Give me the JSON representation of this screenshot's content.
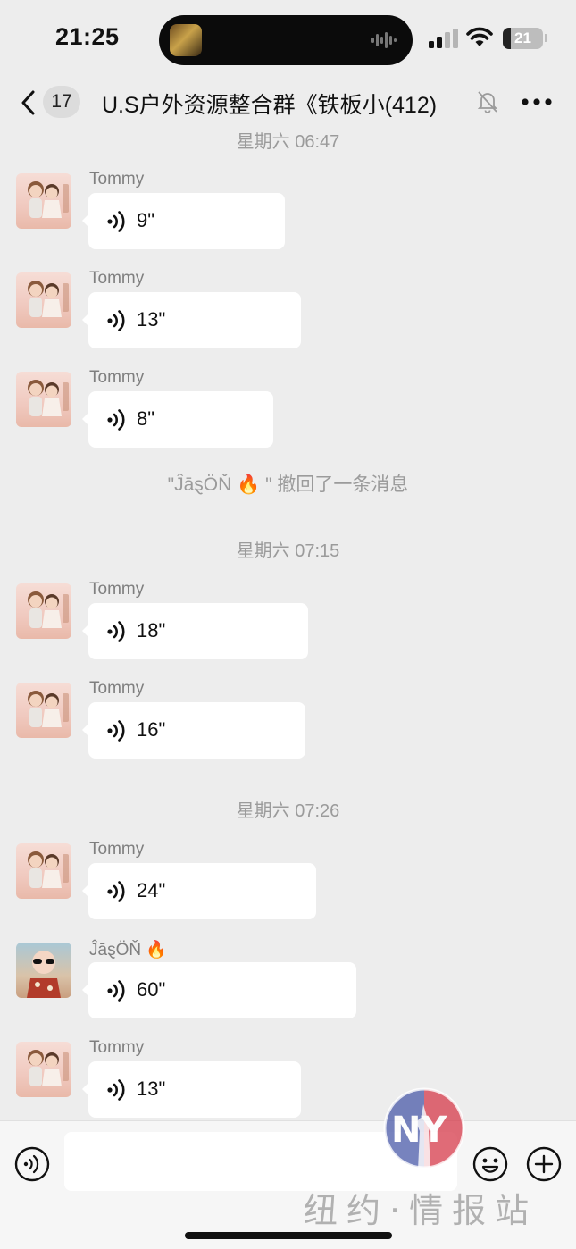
{
  "status_bar": {
    "time": "21:25",
    "battery_level": "21",
    "battery_percent": 21
  },
  "nav": {
    "back_icon": "chevron-left-icon",
    "unread_count": "17",
    "title": "U.S户外资源整合群《铁板小",
    "member_count": "(412)",
    "mute_icon": "bell-slash-icon",
    "more_icon": "ellipsis-icon"
  },
  "timeline": {
    "divider_1": "星期六 06:47",
    "divider_2": "星期六 07:15",
    "divider_3": "星期六 07:26",
    "recall_notice": "\"ĴāȿÖŇ 🔥 \" 撤回了一条消息"
  },
  "messages": [
    {
      "sender": "Tommy",
      "duration": "9\""
    },
    {
      "sender": "Tommy",
      "duration": "13\""
    },
    {
      "sender": "Tommy",
      "duration": "8\""
    },
    {
      "sender": "Tommy",
      "duration": "18\""
    },
    {
      "sender": "Tommy",
      "duration": "16\""
    },
    {
      "sender": "Tommy",
      "duration": "24\""
    },
    {
      "sender": "ĴāȿÖŇ 🔥",
      "duration": "60\""
    },
    {
      "sender": "Tommy",
      "duration": "13\""
    }
  ],
  "input_bar": {
    "placeholder": "",
    "voice_icon": "voice-mode-icon",
    "emoji_icon": "emoji-icon",
    "plus_icon": "plus-circle-icon"
  },
  "watermark": {
    "logo_text": "NY",
    "text": "纽约·情报站"
  },
  "colors": {
    "background": "#ededed",
    "bubble": "#ffffff",
    "meta_text": "#9b9b9b"
  }
}
